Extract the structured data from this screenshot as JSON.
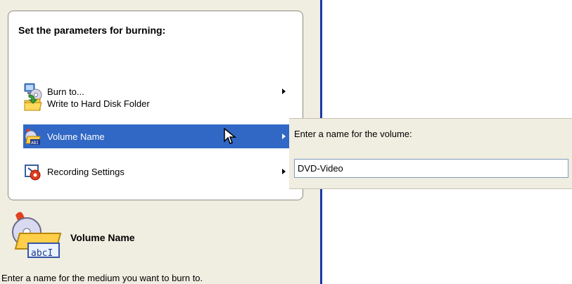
{
  "menu": {
    "title": "Set the parameters for burning:",
    "items": [
      {
        "label": "Burn to...",
        "icon": "burn-disc-icon",
        "has_submenu": true
      },
      {
        "label": "Write to Hard Disk Folder",
        "icon": "folder-arrow-icon",
        "has_submenu": false
      },
      {
        "label": "Volume Name",
        "icon": "volume-name-icon",
        "has_submenu": true,
        "selected": true
      },
      {
        "label": "Recording Settings",
        "icon": "recording-settings-icon",
        "has_submenu": true
      }
    ]
  },
  "submenu": {
    "label": "Enter a name for the volume:",
    "input_value": "DVD-Video"
  },
  "info": {
    "icon": "volume-name-large-icon",
    "icon_badge": "abcI",
    "title": "Volume Name",
    "description": "Enter a name for the medium you want to burn to."
  },
  "colors": {
    "selection": "#3168c5",
    "panel": "#f0ede1",
    "divider": "#1b39a6"
  }
}
